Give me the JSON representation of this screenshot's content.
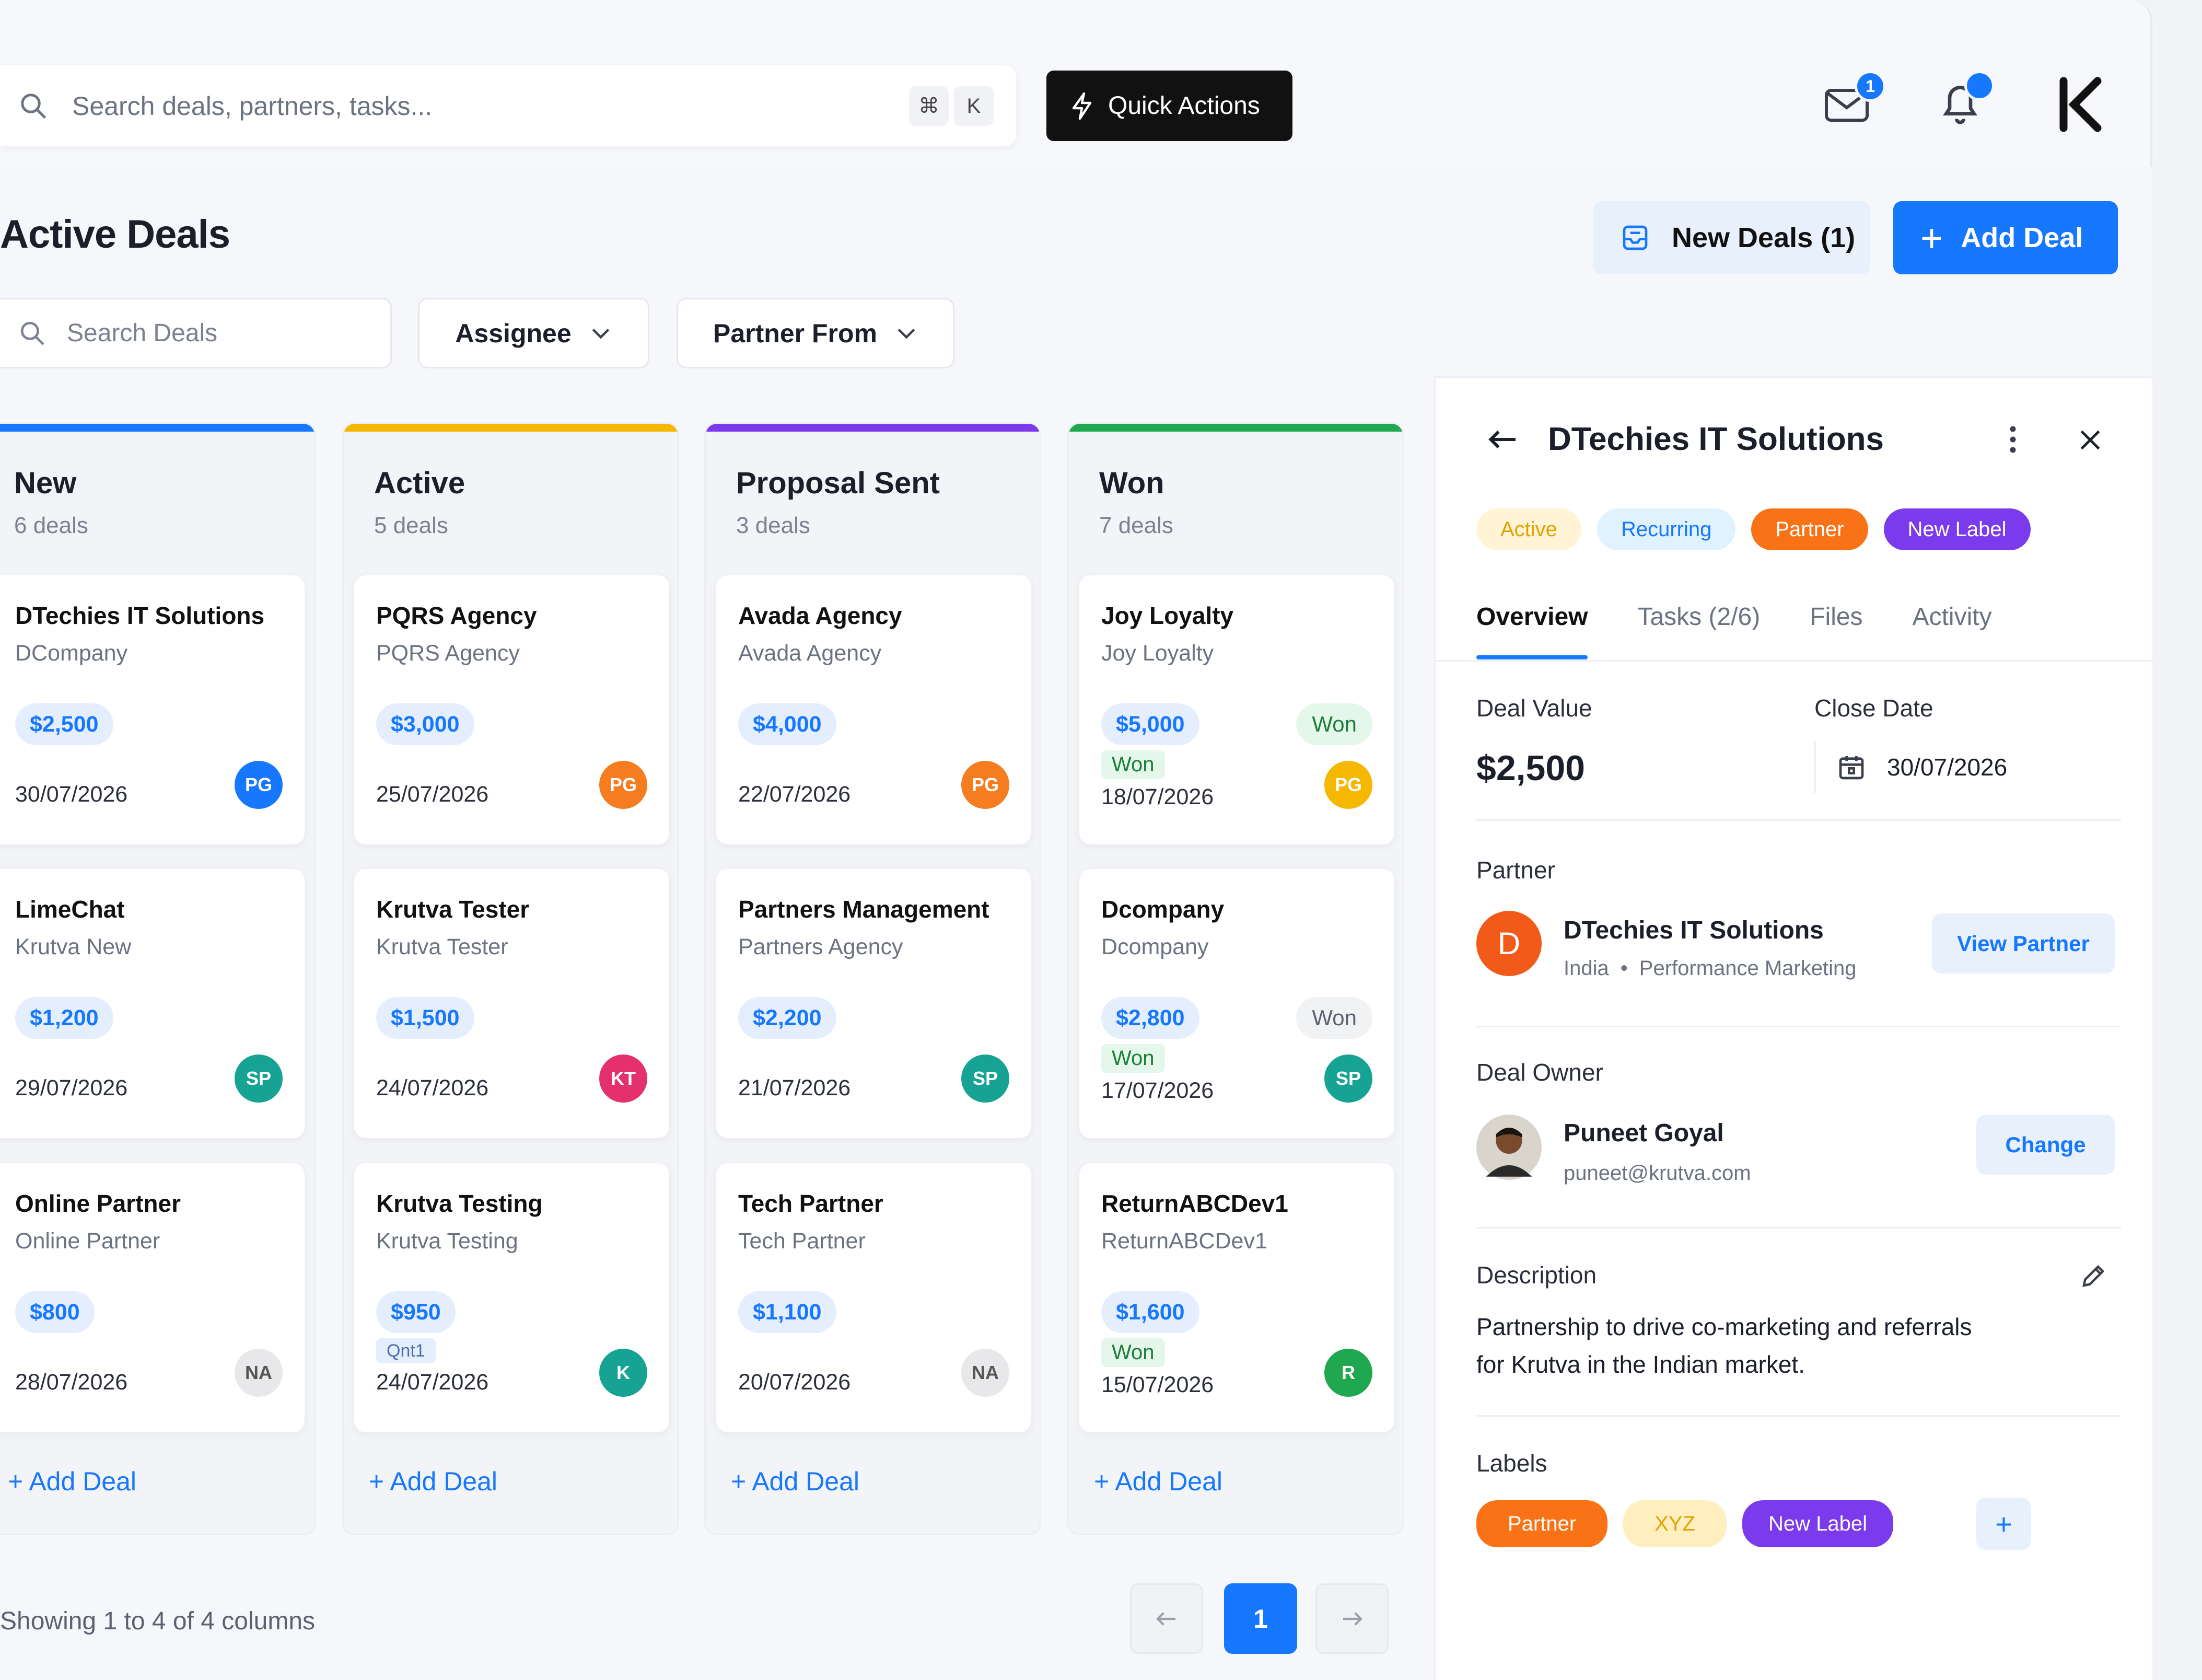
{
  "search": {
    "placeholder": "Search deals, partners, tasks...",
    "shortcut_1": "⌘",
    "shortcut_2": "K"
  },
  "quick_actions": "Quick Actions",
  "notifications": {
    "mail_count": "1"
  },
  "page": {
    "title": "Active Deals",
    "new_deals_btn": "New Deals (1)",
    "add_deal_btn": "Add Deal"
  },
  "filters": {
    "search_placeholder": "Search Deals",
    "assignee": "Assignee",
    "partner_from": "Partner From"
  },
  "colors": {
    "blue": "#1677ff",
    "amber": "#f5b700",
    "purple": "#7c3aed",
    "green": "#1fa84f"
  },
  "columns": [
    {
      "title": "New",
      "count": "6 deals",
      "color": "#1677ff",
      "add": "+ Add Deal",
      "cards": [
        {
          "name": "DTechies IT Solutions",
          "company": "DCompany",
          "value": "$2,500",
          "date": "30/07/2026",
          "avatar": "PG",
          "avatar_color": "#1677ff"
        },
        {
          "name": "LimeChat",
          "company": "Krutva New",
          "value": "$1,200",
          "date": "29/07/2026",
          "avatar": "SP",
          "avatar_color": "#16a394"
        },
        {
          "name": "Online Partner",
          "company": "Online Partner",
          "value": "$800",
          "date": "28/07/2026",
          "avatar": "NA",
          "avatar_color": "#e8e8ea"
        }
      ]
    },
    {
      "title": "Active",
      "count": "5 deals",
      "color": "#f5b700",
      "add": "+ Add Deal",
      "cards": [
        {
          "name": "PQRS Agency",
          "company": "PQRS Agency",
          "value": "$3,000",
          "date": "25/07/2026",
          "avatar": "PG",
          "avatar_color": "#f57c1f"
        },
        {
          "name": "Krutva Tester",
          "company": "Krutva Tester",
          "value": "$1,500",
          "date": "24/07/2026",
          "avatar": "KT",
          "avatar_color": "#e5306e"
        },
        {
          "name": "Krutva Testing",
          "company": "Krutva Testing",
          "value": "$950",
          "date": "24/07/2026",
          "avatar": "K",
          "avatar_color": "#16a394",
          "small_tag": "Qnt1"
        }
      ]
    },
    {
      "title": "Proposal Sent",
      "count": "3 deals",
      "color": "#7c3aed",
      "add": "+ Add Deal",
      "cards": [
        {
          "name": "Avada Agency",
          "company": "Avada Agency",
          "value": "$4,000",
          "date": "22/07/2026",
          "avatar": "PG",
          "avatar_color": "#f57c1f"
        },
        {
          "name": "Partners Management",
          "company": "Partners Agency",
          "value": "$2,200",
          "date": "21/07/2026",
          "avatar": "SP",
          "avatar_color": "#16a394"
        },
        {
          "name": "Tech Partner",
          "company": "Tech Partner",
          "value": "$1,100",
          "date": "20/07/2026",
          "avatar": "NA",
          "avatar_color": "#e8e8ea"
        }
      ]
    },
    {
      "title": "Won",
      "count": "7 deals",
      "color": "#1fa84f",
      "add": "+ Add Deal",
      "cards": [
        {
          "name": "Joy Loyalty",
          "company": "Joy Loyalty",
          "value": "$5,000",
          "date": "18/07/2026",
          "avatar": "PG",
          "avatar_color": "#f5b700",
          "status": "Won",
          "status_small": "Won"
        },
        {
          "name": "Dcompany",
          "company": "Dcompany",
          "value": "$2,800",
          "date": "17/07/2026",
          "avatar": "SP",
          "avatar_color": "#16a394",
          "status": "Won",
          "status_small": "Won"
        },
        {
          "name": "ReturnABCDev1",
          "company": "ReturnABCDev1",
          "value": "$1,600",
          "date": "15/07/2026",
          "avatar": "R",
          "avatar_color": "#1fa84f",
          "status_small": "Won"
        }
      ]
    }
  ],
  "footer": {
    "showing": "Showing 1 to 4 of 4 columns",
    "page": "1"
  },
  "detail": {
    "title": "DTechies IT Solutions",
    "tags": [
      "Active",
      "Recurring",
      "Partner",
      "New Label"
    ],
    "tabs": [
      "Overview",
      "Tasks (2/6)",
      "Files",
      "Activity"
    ],
    "deal_value_label": "Deal Value",
    "deal_value": "$2,500",
    "close_date_label": "Close Date",
    "close_date": "30/07/2026",
    "partner_label": "Partner",
    "partner_initial": "D",
    "partner_name": "DTechies IT Solutions",
    "partner_country": "India",
    "partner_type": "Performance Marketing",
    "view_partner": "View Partner",
    "owner_label": "Deal Owner",
    "owner_name": "Puneet Goyal",
    "owner_email": "puneet@krutva.com",
    "change": "Change",
    "description_label": "Description",
    "description": "Partnership to drive co-marketing and referrals for Krutva in the Indian market.",
    "labels_label": "Labels",
    "labels": [
      "Partner",
      "XYZ",
      "New Label"
    ],
    "add_label": "+"
  }
}
